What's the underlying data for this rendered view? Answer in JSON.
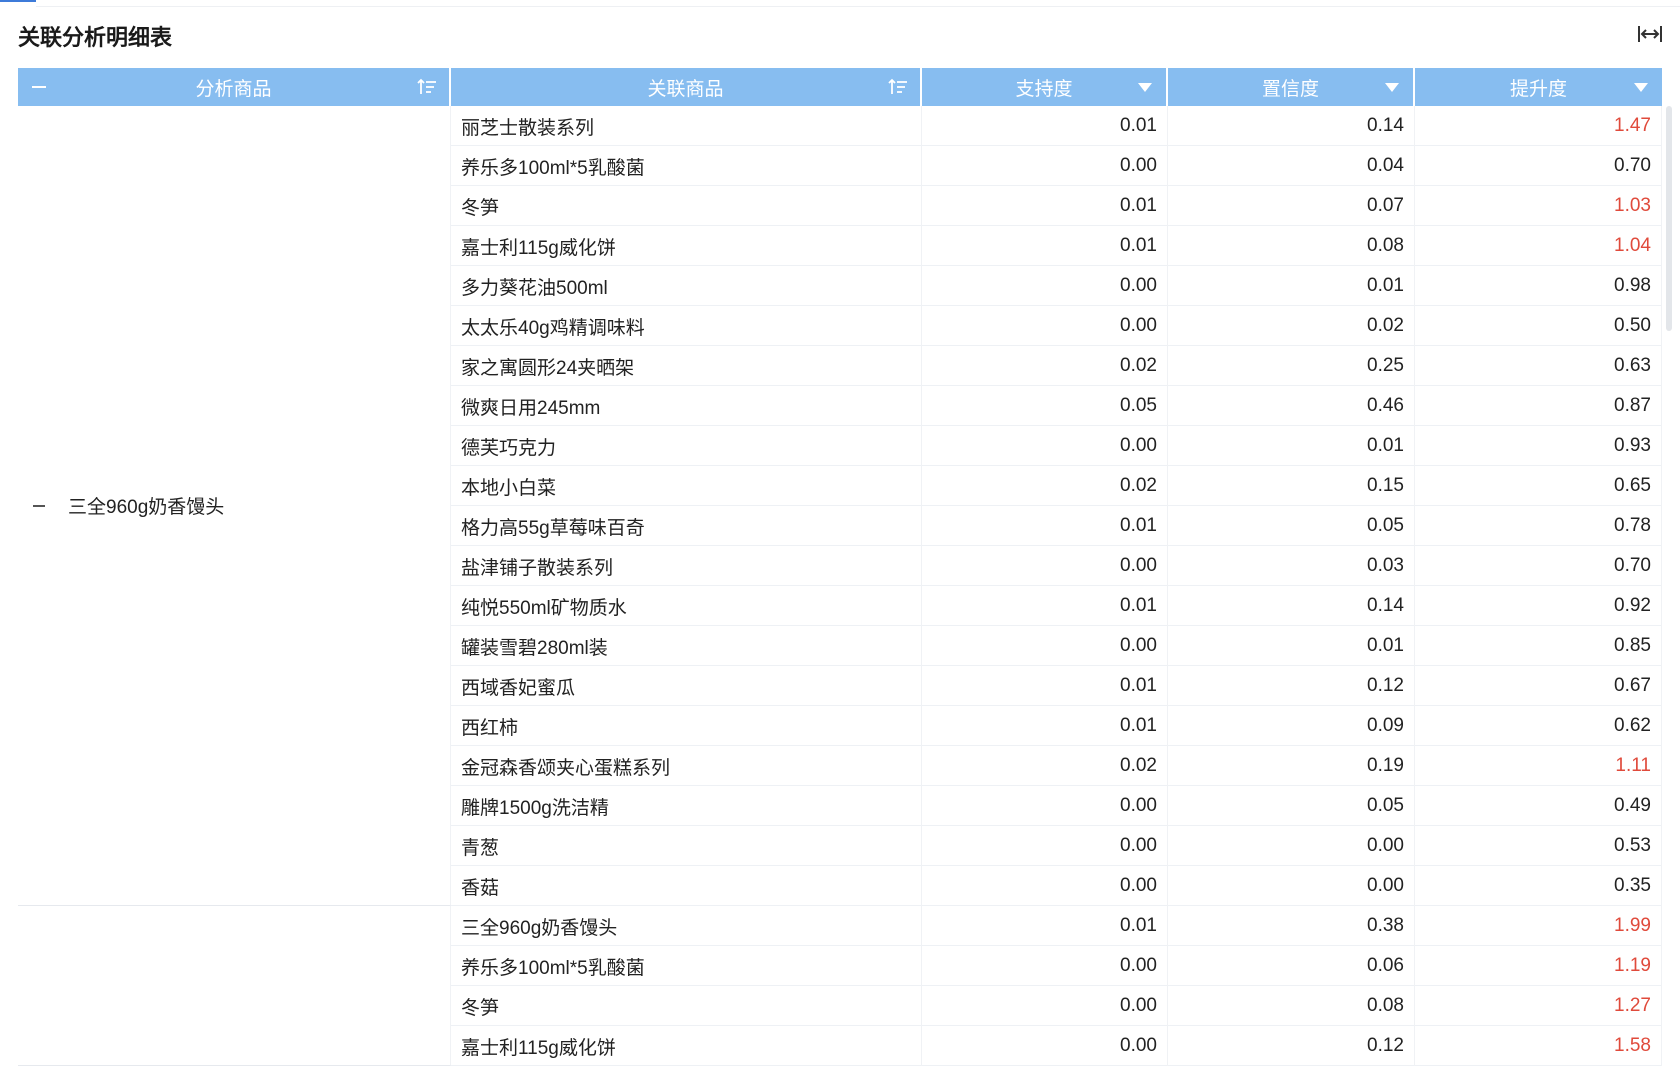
{
  "title": "关联分析明细表",
  "columns": {
    "analysis_item": "分析商品",
    "related_item": "关联商品",
    "support": "支持度",
    "confidence": "置信度",
    "lift": "提升度"
  },
  "colors": {
    "header": "#87bdf0",
    "highlight": "#e04a3b"
  },
  "groups": [
    {
      "label": "三全960g奶香馒头",
      "rows": [
        {
          "item": "丽芝士散装系列",
          "support": "0.01",
          "confidence": "0.14",
          "lift": "1.47",
          "highlight": true
        },
        {
          "item": "养乐多100ml*5乳酸菌",
          "support": "0.00",
          "confidence": "0.04",
          "lift": "0.70",
          "highlight": false
        },
        {
          "item": "冬笋",
          "support": "0.01",
          "confidence": "0.07",
          "lift": "1.03",
          "highlight": true
        },
        {
          "item": "嘉士利115g威化饼",
          "support": "0.01",
          "confidence": "0.08",
          "lift": "1.04",
          "highlight": true
        },
        {
          "item": "多力葵花油500ml",
          "support": "0.00",
          "confidence": "0.01",
          "lift": "0.98",
          "highlight": false
        },
        {
          "item": "太太乐40g鸡精调味料",
          "support": "0.00",
          "confidence": "0.02",
          "lift": "0.50",
          "highlight": false
        },
        {
          "item": "家之寓圆形24夹晒架",
          "support": "0.02",
          "confidence": "0.25",
          "lift": "0.63",
          "highlight": false
        },
        {
          "item": "微爽日用245mm",
          "support": "0.05",
          "confidence": "0.46",
          "lift": "0.87",
          "highlight": false
        },
        {
          "item": "德芙巧克力",
          "support": "0.00",
          "confidence": "0.01",
          "lift": "0.93",
          "highlight": false
        },
        {
          "item": "本地小白菜",
          "support": "0.02",
          "confidence": "0.15",
          "lift": "0.65",
          "highlight": false
        },
        {
          "item": "格力高55g草莓味百奇",
          "support": "0.01",
          "confidence": "0.05",
          "lift": "0.78",
          "highlight": false
        },
        {
          "item": "盐津铺子散装系列",
          "support": "0.00",
          "confidence": "0.03",
          "lift": "0.70",
          "highlight": false
        },
        {
          "item": "纯悦550ml矿物质水",
          "support": "0.01",
          "confidence": "0.14",
          "lift": "0.92",
          "highlight": false
        },
        {
          "item": "罐装雪碧280ml装",
          "support": "0.00",
          "confidence": "0.01",
          "lift": "0.85",
          "highlight": false
        },
        {
          "item": "西域香妃蜜瓜",
          "support": "0.01",
          "confidence": "0.12",
          "lift": "0.67",
          "highlight": false
        },
        {
          "item": "西红柿",
          "support": "0.01",
          "confidence": "0.09",
          "lift": "0.62",
          "highlight": false
        },
        {
          "item": "金冠森香颂夹心蛋糕系列",
          "support": "0.02",
          "confidence": "0.19",
          "lift": "1.11",
          "highlight": true
        },
        {
          "item": "雕牌1500g洗洁精",
          "support": "0.00",
          "confidence": "0.05",
          "lift": "0.49",
          "highlight": false
        },
        {
          "item": "青葱",
          "support": "0.00",
          "confidence": "0.00",
          "lift": "0.53",
          "highlight": false
        },
        {
          "item": "香菇",
          "support": "0.00",
          "confidence": "0.00",
          "lift": "0.35",
          "highlight": false
        }
      ]
    },
    {
      "label": "",
      "rows": [
        {
          "item": "三全960g奶香馒头",
          "support": "0.01",
          "confidence": "0.38",
          "lift": "1.99",
          "highlight": true
        },
        {
          "item": "养乐多100ml*5乳酸菌",
          "support": "0.00",
          "confidence": "0.06",
          "lift": "1.19",
          "highlight": true
        },
        {
          "item": "冬笋",
          "support": "0.00",
          "confidence": "0.08",
          "lift": "1.27",
          "highlight": true
        },
        {
          "item": "嘉士利115g威化饼",
          "support": "0.00",
          "confidence": "0.12",
          "lift": "1.58",
          "highlight": true
        }
      ]
    }
  ]
}
